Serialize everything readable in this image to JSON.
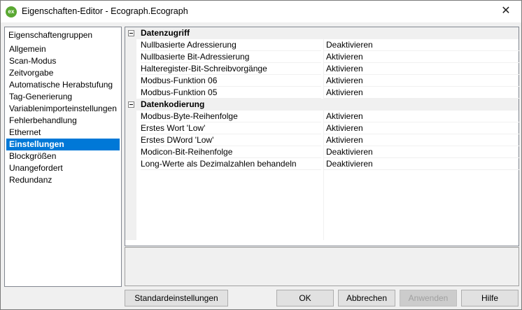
{
  "window": {
    "title": "Eigenschaften-Editor - Ecograph.Ecograph",
    "icon_text": "ex",
    "close_glyph": "✕"
  },
  "sidebar": {
    "header": "Eigenschaftengruppen",
    "items": [
      {
        "label": "Allgemein"
      },
      {
        "label": "Scan-Modus"
      },
      {
        "label": "Zeitvorgabe"
      },
      {
        "label": "Automatische Herabstufung"
      },
      {
        "label": "Tag-Generierung"
      },
      {
        "label": "Variablenimporteinstellungen"
      },
      {
        "label": "Fehlerbehandlung"
      },
      {
        "label": "Ethernet"
      },
      {
        "label": "Einstellungen",
        "selected": true
      },
      {
        "label": "Blockgrößen"
      },
      {
        "label": "Unangefordert"
      },
      {
        "label": "Redundanz"
      }
    ]
  },
  "grid": {
    "categories": [
      {
        "name": "Datenzugriff",
        "properties": [
          {
            "name": "Nullbasierte Adressierung",
            "value": "Deaktivieren"
          },
          {
            "name": "Nullbasierte Bit-Adressierung",
            "value": "Aktivieren"
          },
          {
            "name": "Halteregister-Bit-Schreibvorgänge",
            "value": "Aktivieren"
          },
          {
            "name": "Modbus-Funktion 06",
            "value": "Aktivieren"
          },
          {
            "name": "Modbus-Funktion 05",
            "value": "Aktivieren"
          }
        ]
      },
      {
        "name": "Datenkodierung",
        "properties": [
          {
            "name": "Modbus-Byte-Reihenfolge",
            "value": "Aktivieren"
          },
          {
            "name": "Erstes Wort 'Low'",
            "value": "Aktivieren"
          },
          {
            "name": "Erstes DWord 'Low'",
            "value": "Aktivieren"
          },
          {
            "name": "Modicon-Bit-Reihenfolge",
            "value": "Deaktivieren"
          },
          {
            "name": "Long-Werte als Dezimalzahlen behandeln",
            "value": "Deaktivieren"
          }
        ]
      }
    ]
  },
  "buttons": {
    "defaults": "Standardeinstellungen",
    "ok": "OK",
    "cancel": "Abbrechen",
    "apply": "Anwenden",
    "help": "Hilfe"
  },
  "colors": {
    "selection": "#0078d7",
    "app_icon": "#5aa832"
  }
}
